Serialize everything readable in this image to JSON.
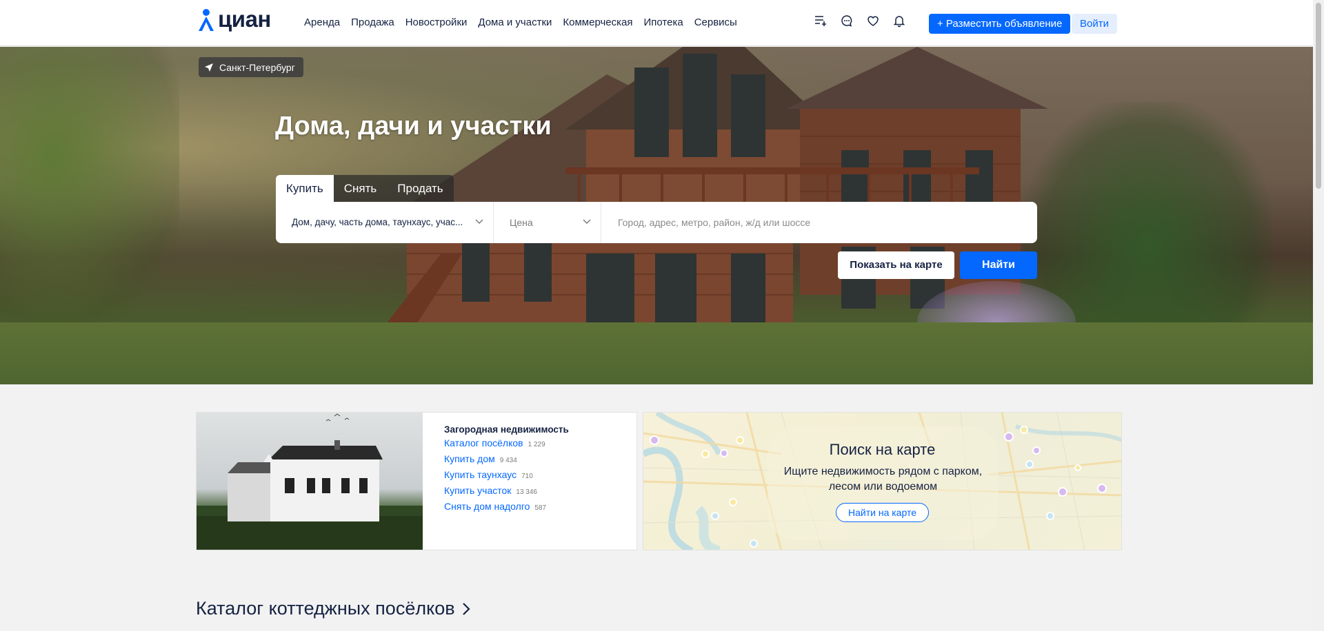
{
  "header": {
    "logo_text": "циан",
    "nav": [
      "Аренда",
      "Продажа",
      "Новостройки",
      "Дома и участки",
      "Коммерческая",
      "Ипотека",
      "Сервисы"
    ],
    "icons": [
      "compare-list-icon",
      "chat-icon",
      "heart-icon",
      "bell-icon"
    ],
    "post_button": "+ Разместить объявление",
    "login_button": "Войти"
  },
  "hero": {
    "city": "Санкт-Петербург",
    "title": "Дома, дачи и участки",
    "tabs": [
      {
        "label": "Купить",
        "active": true
      },
      {
        "label": "Снять",
        "active": false
      },
      {
        "label": "Продать",
        "active": false
      }
    ],
    "property_type": "Дом, дачу, часть дома, таунхаус, учас...",
    "price_placeholder": "Цена",
    "location_placeholder": "Город, адрес, метро, район, ж/д или шоссе",
    "show_on_map_button": "Показать на карте",
    "find_button": "Найти"
  },
  "country_card": {
    "title": "Загородная недвижимость",
    "links": [
      {
        "label": "Каталог посёлков",
        "count": "1 229"
      },
      {
        "label": "Купить дом",
        "count": "9 434"
      },
      {
        "label": "Купить таунхаус",
        "count": "710"
      },
      {
        "label": "Купить участок",
        "count": "13 346"
      },
      {
        "label": "Снять дом надолго",
        "count": "587"
      }
    ]
  },
  "map_card": {
    "title": "Поиск на карте",
    "subtitle": "Ищите недвижимость рядом с парком, лесом или водоемом",
    "button": "Найти на карте"
  },
  "section": {
    "title": "Каталог коттеджных посёлков"
  },
  "colors": {
    "accent": "#0468ff",
    "text": "#152242",
    "bg": "#f2f2f2"
  }
}
